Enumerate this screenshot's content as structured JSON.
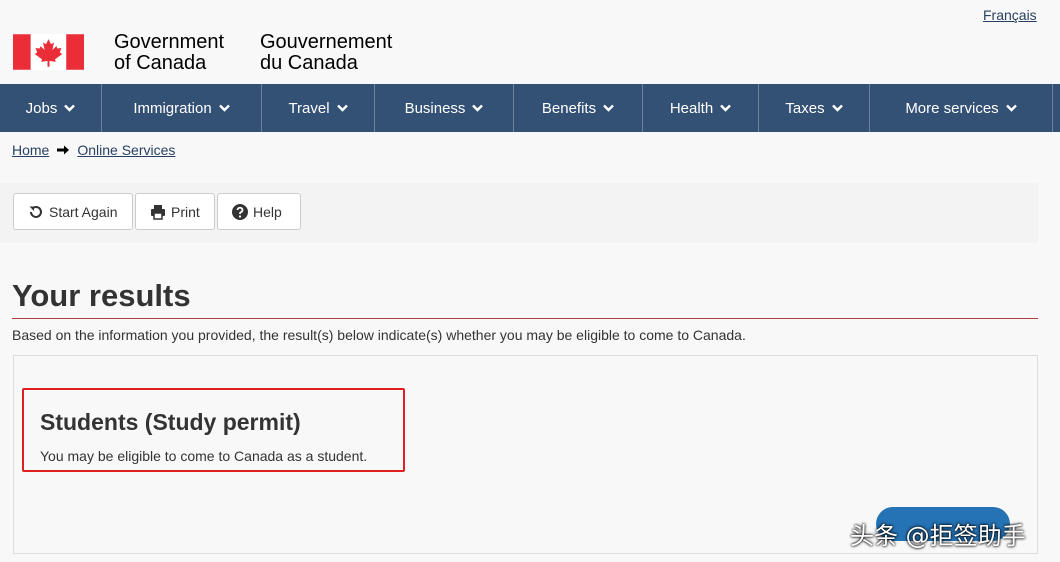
{
  "lang_toggle": "Français",
  "signature": {
    "en_line1": "Government",
    "en_line2": "of Canada",
    "fr_line1": "Gouvernement",
    "fr_line2": "du Canada"
  },
  "menu": [
    {
      "label": "Jobs"
    },
    {
      "label": "Immigration"
    },
    {
      "label": "Travel"
    },
    {
      "label": "Business"
    },
    {
      "label": "Benefits"
    },
    {
      "label": "Health"
    },
    {
      "label": "Taxes"
    },
    {
      "label": "More services"
    }
  ],
  "breadcrumb": {
    "home": "Home",
    "current": "Online Services"
  },
  "toolbar": {
    "start_again": "Start Again",
    "print": "Print",
    "help": "Help"
  },
  "page_title": "Your results",
  "intro": "Based on the information you provided, the result(s) below indicate(s) whether you may be eligible to come to Canada.",
  "result": {
    "title": "Students (Study permit)",
    "text": "You may be eligible to come to Canada as a student."
  },
  "watermark": "头条 @拒签助手",
  "colors": {
    "menu_bg": "#335075",
    "accent_rule": "#af3c43",
    "highlight_border": "#e02020",
    "flag_red": "#eb2d37"
  }
}
